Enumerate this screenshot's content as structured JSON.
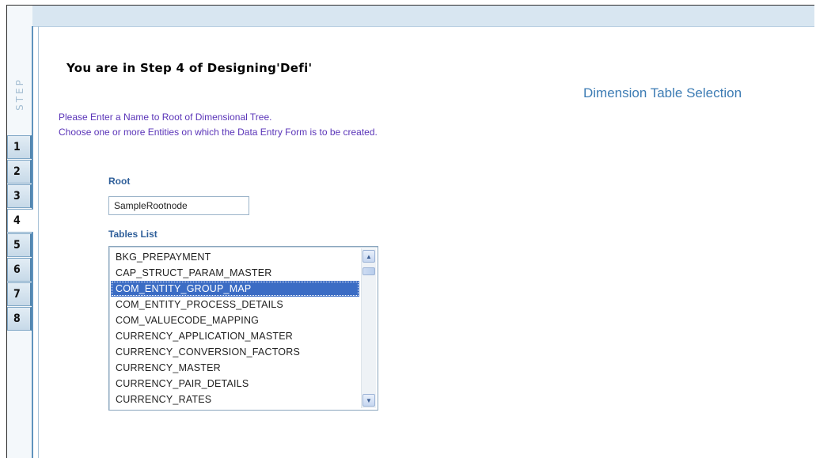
{
  "wizard": {
    "rail_label": "STEP",
    "steps": [
      "1",
      "2",
      "3",
      "4",
      "5",
      "6",
      "7",
      "8"
    ],
    "active_step": "4"
  },
  "header": {
    "heading": "You are in Step 4 of Designing'Defi'",
    "section_title": "Dimension Table Selection"
  },
  "instructions": {
    "line1": "Please Enter a Name to Root of Dimensional Tree.",
    "line2": "Choose one or more Entities on which the Data Entry Form is to be created."
  },
  "root": {
    "label": "Root",
    "value": "SampleRootnode"
  },
  "tables": {
    "label": "Tables List",
    "items": [
      "BKG_PREPAYMENT",
      "CAP_STRUCT_PARAM_MASTER",
      "COM_ENTITY_GROUP_MAP",
      "COM_ENTITY_PROCESS_DETAILS",
      "COM_VALUECODE_MAPPING",
      "CURRENCY_APPLICATION_MASTER",
      "CURRENCY_CONVERSION_FACTORS",
      "CURRENCY_MASTER",
      "CURRENCY_PAIR_DETAILS",
      "CURRENCY_RATES"
    ],
    "selected": "COM_ENTITY_GROUP_MAP"
  },
  "icons": {
    "scroll_up": "chevron-up-icon",
    "scroll_down": "chevron-down-icon"
  },
  "colors": {
    "selection": "#3b6cc4",
    "instruction_text": "#5a34b8",
    "section_title": "#3d7cb4"
  }
}
